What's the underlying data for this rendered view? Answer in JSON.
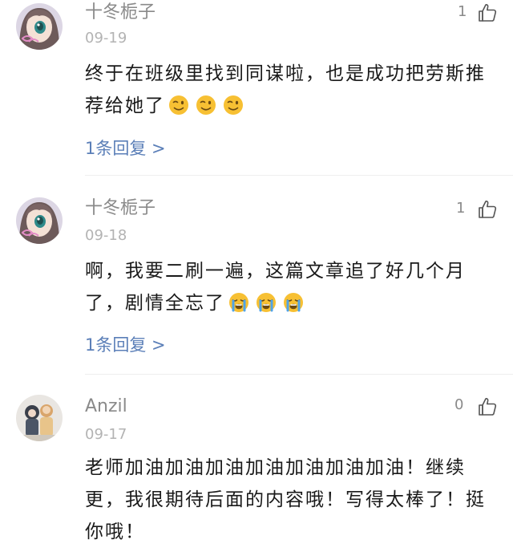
{
  "comments": [
    {
      "username": "十冬栀子",
      "date": "09-19",
      "like_count": "1",
      "text": "终于在班级里找到同谋啦，也是成功把劳斯推荐给她了",
      "emoji_kind": "wink",
      "reply_label": "1条回复 >"
    },
    {
      "username": "十冬栀子",
      "date": "09-18",
      "like_count": "1",
      "text": "啊，我要二刷一遍，这篇文章追了好几个月了，剧情全忘了",
      "emoji_kind": "crying",
      "reply_label": "1条回复 >"
    },
    {
      "username": "Anzil",
      "date": "09-17",
      "like_count": "0",
      "text": "老师加油加油加油加油加油加油加油！继续更，我很期待后面的内容哦！写得太棒了！挺你哦！"
    }
  ],
  "icons": {
    "like": "thumbs-up-icon",
    "emoji_wink": "winking-face-icon",
    "emoji_crying": "loudly-crying-face-icon"
  },
  "colors": {
    "username": "#8a8a8a",
    "date": "#b3b3b3",
    "text": "#1a1a1a",
    "reply_link": "#5b7fb8",
    "divider": "#eeeeee"
  }
}
